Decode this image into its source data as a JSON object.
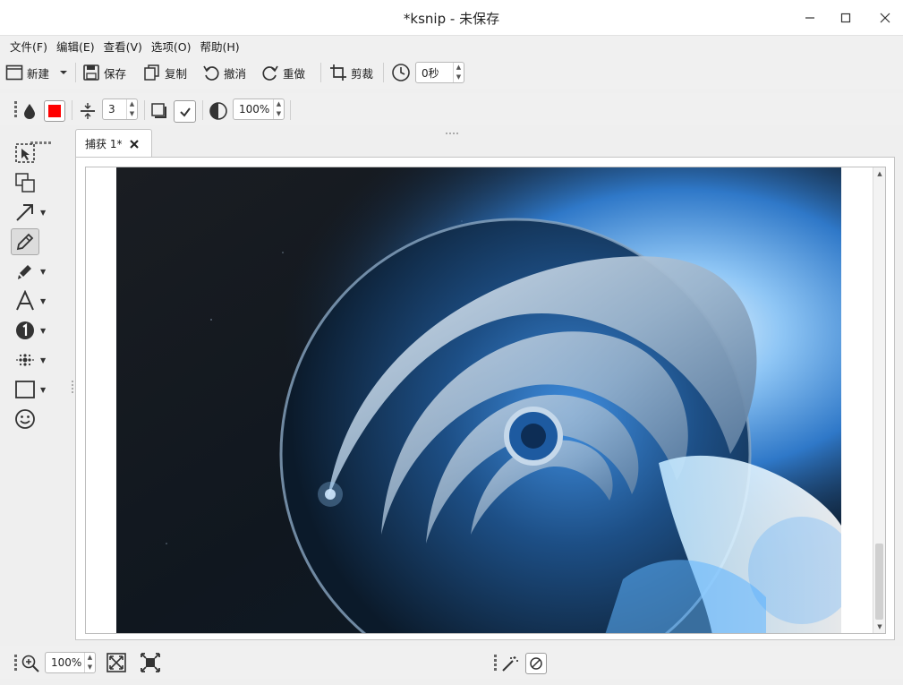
{
  "window": {
    "title": "*ksnip - 未保存"
  },
  "menu": {
    "items": [
      "文件(F)",
      "编辑(E)",
      "查看(V)",
      "选项(O)",
      "帮助(H)"
    ]
  },
  "toolbar": {
    "new_label": "新建",
    "save_label": "保存",
    "copy_label": "复制",
    "undo_label": "撤消",
    "redo_label": "重做",
    "crop_label": "剪裁",
    "delay_value": "0秒"
  },
  "properties": {
    "color": "#ff0000",
    "width_value": "3",
    "opacity_value": "100%"
  },
  "tabs": [
    {
      "label": "捕获 1*"
    }
  ],
  "status": {
    "zoom_value": "100%"
  },
  "colors": {
    "accent": "#3b8fe8",
    "toolbar_bg": "#f0f0f0"
  }
}
